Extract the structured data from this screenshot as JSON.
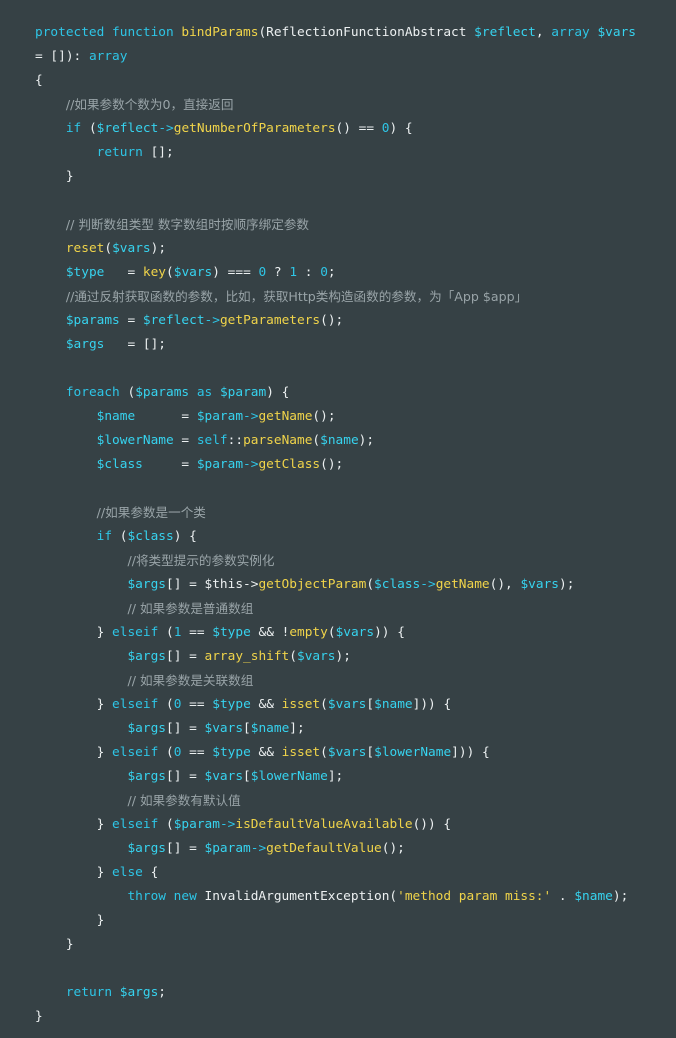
{
  "colors": {
    "background": "#364145",
    "keyword": "#2ec5e6",
    "function": "#f0d44a",
    "variable": "#36d3ef",
    "comment": "#99a4a8",
    "plain": "#ecf0f1"
  },
  "code": {
    "language": "php",
    "lines": [
      [
        [
          "keyword",
          "protected function "
        ],
        [
          "function",
          "bindParams"
        ],
        [
          "plain",
          "(ReflectionFunctionAbstract "
        ],
        [
          "variable",
          "$reflect"
        ],
        [
          "plain",
          ", "
        ],
        [
          "keyword",
          "array "
        ],
        [
          "variable",
          "$vars"
        ]
      ],
      [
        [
          "plain",
          "= []): "
        ],
        [
          "keyword",
          "array"
        ]
      ],
      [
        [
          "plain",
          "{"
        ]
      ],
      [
        [
          "plain",
          "    "
        ],
        [
          "comment",
          "//如果参数个数为0，直接返回"
        ]
      ],
      [
        [
          "plain",
          "    "
        ],
        [
          "keyword",
          "if "
        ],
        [
          "plain",
          "("
        ],
        [
          "variable",
          "$reflect"
        ],
        [
          "keyword",
          "->"
        ],
        [
          "function",
          "getNumberOfParameters"
        ],
        [
          "plain",
          "() == "
        ],
        [
          "number",
          "0"
        ],
        [
          "plain",
          ") {"
        ]
      ],
      [
        [
          "plain",
          "        "
        ],
        [
          "keyword",
          "return "
        ],
        [
          "plain",
          "[];"
        ]
      ],
      [
        [
          "plain",
          "    }"
        ]
      ],
      [
        [
          "plain",
          ""
        ]
      ],
      [
        [
          "plain",
          "    "
        ],
        [
          "comment",
          "// 判断数组类型 数字数组时按顺序绑定参数"
        ]
      ],
      [
        [
          "plain",
          "    "
        ],
        [
          "function",
          "reset"
        ],
        [
          "plain",
          "("
        ],
        [
          "variable",
          "$vars"
        ],
        [
          "plain",
          ");"
        ]
      ],
      [
        [
          "plain",
          "    "
        ],
        [
          "variable",
          "$type"
        ],
        [
          "plain",
          "   = "
        ],
        [
          "function",
          "key"
        ],
        [
          "plain",
          "("
        ],
        [
          "variable",
          "$vars"
        ],
        [
          "plain",
          ") === "
        ],
        [
          "number",
          "0"
        ],
        [
          "plain",
          " ? "
        ],
        [
          "number",
          "1"
        ],
        [
          "plain",
          " : "
        ],
        [
          "number",
          "0"
        ],
        [
          "plain",
          ";"
        ]
      ],
      [
        [
          "plain",
          "    "
        ],
        [
          "comment",
          "//通过反射获取函数的参数，比如，获取Http类构造函数的参数，为「App $app」"
        ]
      ],
      [
        [
          "plain",
          "    "
        ],
        [
          "variable",
          "$params"
        ],
        [
          "plain",
          " = "
        ],
        [
          "variable",
          "$reflect"
        ],
        [
          "keyword",
          "->"
        ],
        [
          "function",
          "getParameters"
        ],
        [
          "plain",
          "();"
        ]
      ],
      [
        [
          "plain",
          "    "
        ],
        [
          "variable",
          "$args"
        ],
        [
          "plain",
          "   = [];"
        ]
      ],
      [
        [
          "plain",
          ""
        ]
      ],
      [
        [
          "plain",
          "    "
        ],
        [
          "keyword",
          "foreach "
        ],
        [
          "plain",
          "("
        ],
        [
          "variable",
          "$params"
        ],
        [
          "keyword",
          " as "
        ],
        [
          "variable",
          "$param"
        ],
        [
          "plain",
          ") {"
        ]
      ],
      [
        [
          "plain",
          "        "
        ],
        [
          "variable",
          "$name"
        ],
        [
          "plain",
          "      = "
        ],
        [
          "variable",
          "$param"
        ],
        [
          "keyword",
          "->"
        ],
        [
          "function",
          "getName"
        ],
        [
          "plain",
          "();"
        ]
      ],
      [
        [
          "plain",
          "        "
        ],
        [
          "variable",
          "$lowerName"
        ],
        [
          "plain",
          " = "
        ],
        [
          "keyword",
          "self"
        ],
        [
          "plain",
          "::"
        ],
        [
          "function",
          "parseName"
        ],
        [
          "plain",
          "("
        ],
        [
          "variable",
          "$name"
        ],
        [
          "plain",
          ");"
        ]
      ],
      [
        [
          "plain",
          "        "
        ],
        [
          "variable",
          "$class"
        ],
        [
          "plain",
          "     = "
        ],
        [
          "variable",
          "$param"
        ],
        [
          "keyword",
          "->"
        ],
        [
          "function",
          "getClass"
        ],
        [
          "plain",
          "();"
        ]
      ],
      [
        [
          "plain",
          ""
        ]
      ],
      [
        [
          "plain",
          "        "
        ],
        [
          "comment",
          "//如果参数是一个类"
        ]
      ],
      [
        [
          "plain",
          "        "
        ],
        [
          "keyword",
          "if "
        ],
        [
          "plain",
          "("
        ],
        [
          "variable",
          "$class"
        ],
        [
          "plain",
          ") {"
        ]
      ],
      [
        [
          "plain",
          "            "
        ],
        [
          "comment",
          "//将类型提示的参数实例化"
        ]
      ],
      [
        [
          "plain",
          "            "
        ],
        [
          "variable",
          "$args"
        ],
        [
          "plain",
          "[] = $this->"
        ],
        [
          "function",
          "getObjectParam"
        ],
        [
          "plain",
          "("
        ],
        [
          "variable",
          "$class"
        ],
        [
          "keyword",
          "->"
        ],
        [
          "function",
          "getName"
        ],
        [
          "plain",
          "(), "
        ],
        [
          "variable",
          "$vars"
        ],
        [
          "plain",
          ");"
        ]
      ],
      [
        [
          "plain",
          "            "
        ],
        [
          "comment",
          "// 如果参数是普通数组"
        ]
      ],
      [
        [
          "plain",
          "        } "
        ],
        [
          "keyword",
          "elseif "
        ],
        [
          "plain",
          "("
        ],
        [
          "number",
          "1"
        ],
        [
          "plain",
          " == "
        ],
        [
          "variable",
          "$type"
        ],
        [
          "plain",
          " && !"
        ],
        [
          "function",
          "empty"
        ],
        [
          "plain",
          "("
        ],
        [
          "variable",
          "$vars"
        ],
        [
          "plain",
          ")) {"
        ]
      ],
      [
        [
          "plain",
          "            "
        ],
        [
          "variable",
          "$args"
        ],
        [
          "plain",
          "[] = "
        ],
        [
          "function",
          "array_shift"
        ],
        [
          "plain",
          "("
        ],
        [
          "variable",
          "$vars"
        ],
        [
          "plain",
          ");"
        ]
      ],
      [
        [
          "plain",
          "            "
        ],
        [
          "comment",
          "// 如果参数是关联数组"
        ]
      ],
      [
        [
          "plain",
          "        } "
        ],
        [
          "keyword",
          "elseif "
        ],
        [
          "plain",
          "("
        ],
        [
          "number",
          "0"
        ],
        [
          "plain",
          " == "
        ],
        [
          "variable",
          "$type"
        ],
        [
          "plain",
          " && "
        ],
        [
          "function",
          "isset"
        ],
        [
          "plain",
          "("
        ],
        [
          "variable",
          "$vars"
        ],
        [
          "plain",
          "["
        ],
        [
          "variable",
          "$name"
        ],
        [
          "plain",
          "])) {"
        ]
      ],
      [
        [
          "plain",
          "            "
        ],
        [
          "variable",
          "$args"
        ],
        [
          "plain",
          "[] = "
        ],
        [
          "variable",
          "$vars"
        ],
        [
          "plain",
          "["
        ],
        [
          "variable",
          "$name"
        ],
        [
          "plain",
          "];"
        ]
      ],
      [
        [
          "plain",
          "        } "
        ],
        [
          "keyword",
          "elseif "
        ],
        [
          "plain",
          "("
        ],
        [
          "number",
          "0"
        ],
        [
          "plain",
          " == "
        ],
        [
          "variable",
          "$type"
        ],
        [
          "plain",
          " && "
        ],
        [
          "function",
          "isset"
        ],
        [
          "plain",
          "("
        ],
        [
          "variable",
          "$vars"
        ],
        [
          "plain",
          "["
        ],
        [
          "variable",
          "$lowerName"
        ],
        [
          "plain",
          "])) {"
        ]
      ],
      [
        [
          "plain",
          "            "
        ],
        [
          "variable",
          "$args"
        ],
        [
          "plain",
          "[] = "
        ],
        [
          "variable",
          "$vars"
        ],
        [
          "plain",
          "["
        ],
        [
          "variable",
          "$lowerName"
        ],
        [
          "plain",
          "];"
        ]
      ],
      [
        [
          "plain",
          "            "
        ],
        [
          "comment",
          "// 如果参数有默认值"
        ]
      ],
      [
        [
          "plain",
          "        } "
        ],
        [
          "keyword",
          "elseif "
        ],
        [
          "plain",
          "("
        ],
        [
          "variable",
          "$param"
        ],
        [
          "keyword",
          "->"
        ],
        [
          "function",
          "isDefaultValueAvailable"
        ],
        [
          "plain",
          "()) {"
        ]
      ],
      [
        [
          "plain",
          "            "
        ],
        [
          "variable",
          "$args"
        ],
        [
          "plain",
          "[] = "
        ],
        [
          "variable",
          "$param"
        ],
        [
          "keyword",
          "->"
        ],
        [
          "function",
          "getDefaultValue"
        ],
        [
          "plain",
          "();"
        ]
      ],
      [
        [
          "plain",
          "        } "
        ],
        [
          "keyword",
          "else "
        ],
        [
          "plain",
          "{"
        ]
      ],
      [
        [
          "plain",
          "            "
        ],
        [
          "keyword",
          "throw new "
        ],
        [
          "plain",
          "InvalidArgumentException("
        ],
        [
          "string",
          "'method param miss:'"
        ],
        [
          "plain",
          " . "
        ],
        [
          "variable",
          "$name"
        ],
        [
          "plain",
          ");"
        ]
      ],
      [
        [
          "plain",
          "        }"
        ]
      ],
      [
        [
          "plain",
          "    }"
        ]
      ],
      [
        [
          "plain",
          ""
        ]
      ],
      [
        [
          "plain",
          "    "
        ],
        [
          "keyword",
          "return "
        ],
        [
          "variable",
          "$args"
        ],
        [
          "plain",
          ";"
        ]
      ],
      [
        [
          "plain",
          "}"
        ]
      ]
    ]
  }
}
